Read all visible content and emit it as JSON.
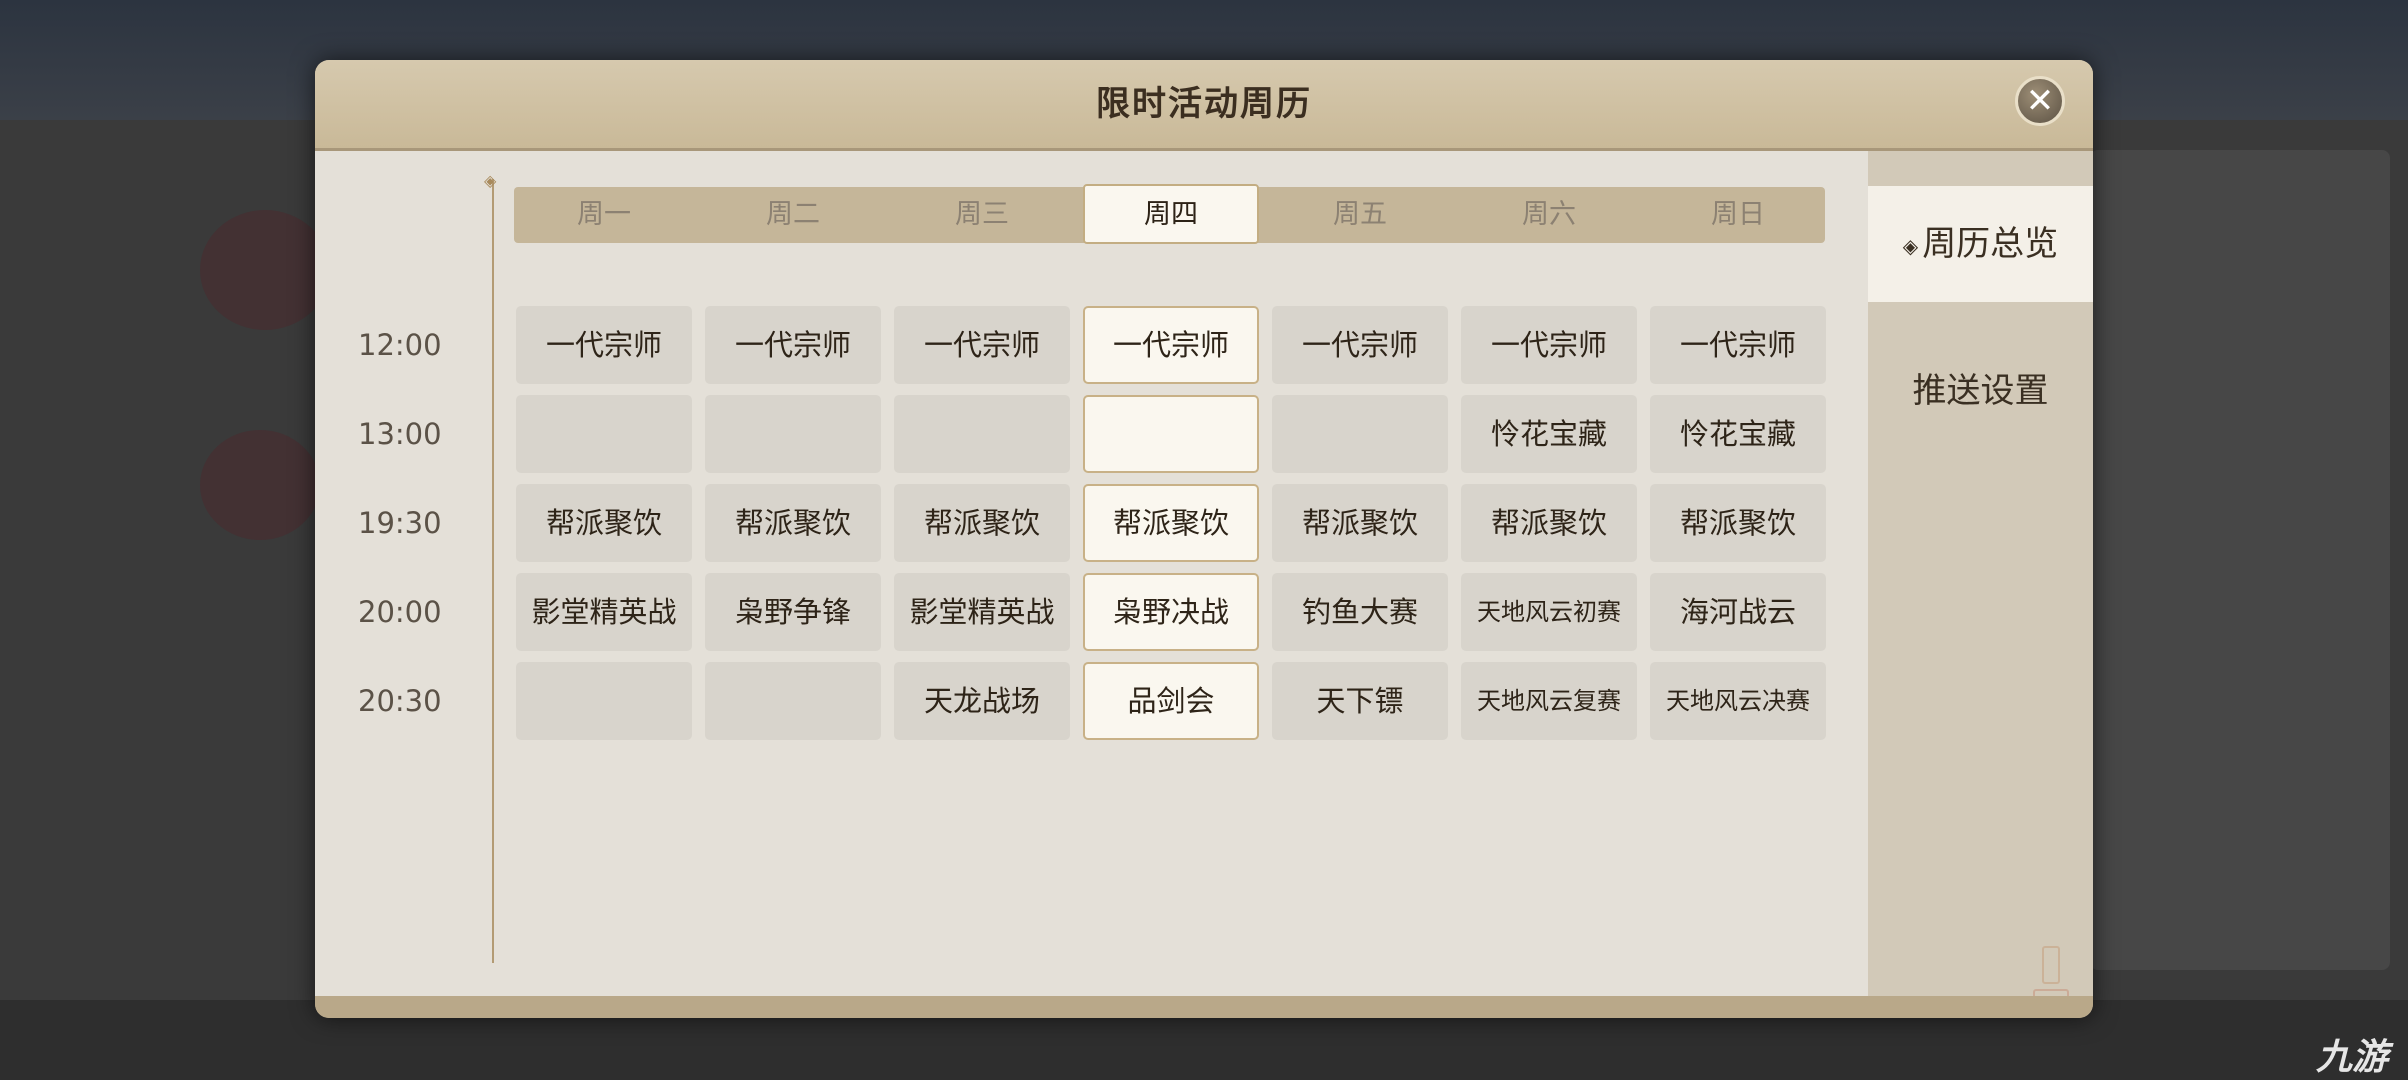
{
  "dialog": {
    "title": "限时活动周历",
    "close_icon": "close-icon"
  },
  "days": [
    {
      "label": "周一",
      "today": false
    },
    {
      "label": "周二",
      "today": false
    },
    {
      "label": "周三",
      "today": false
    },
    {
      "label": "周四",
      "today": true
    },
    {
      "label": "周五",
      "today": false
    },
    {
      "label": "周六",
      "today": false
    },
    {
      "label": "周日",
      "today": false
    }
  ],
  "rows": [
    {
      "time": "12:00",
      "events": [
        "一代宗师",
        "一代宗师",
        "一代宗师",
        "一代宗师",
        "一代宗师",
        "一代宗师",
        "一代宗师"
      ]
    },
    {
      "time": "13:00",
      "events": [
        "",
        "",
        "",
        "",
        "",
        "怜花宝藏",
        "怜花宝藏"
      ]
    },
    {
      "time": "19:30",
      "events": [
        "帮派聚饮",
        "帮派聚饮",
        "帮派聚饮",
        "帮派聚饮",
        "帮派聚饮",
        "帮派聚饮",
        "帮派聚饮"
      ]
    },
    {
      "time": "20:00",
      "events": [
        "影堂精英战",
        "枭野争锋",
        "影堂精英战",
        "枭野决战",
        "钓鱼大赛",
        "天地风云初赛",
        "海河战云"
      ]
    },
    {
      "time": "20:30",
      "events": [
        "",
        "",
        "天龙战场",
        "品剑会",
        "天下镖",
        "天地风云复赛",
        "天地风云决赛"
      ]
    }
  ],
  "sidebar": {
    "items": [
      {
        "label": "周历总览",
        "active": true
      },
      {
        "label": "推送设置",
        "active": false
      }
    ]
  },
  "watermark": "九游",
  "colors": {
    "panel": "#e4e0d8",
    "titlebar": "#d6c9ae",
    "cell": "#d8d4cc",
    "today_cell": "#faf7ef",
    "accent_border": "#c8b187"
  }
}
